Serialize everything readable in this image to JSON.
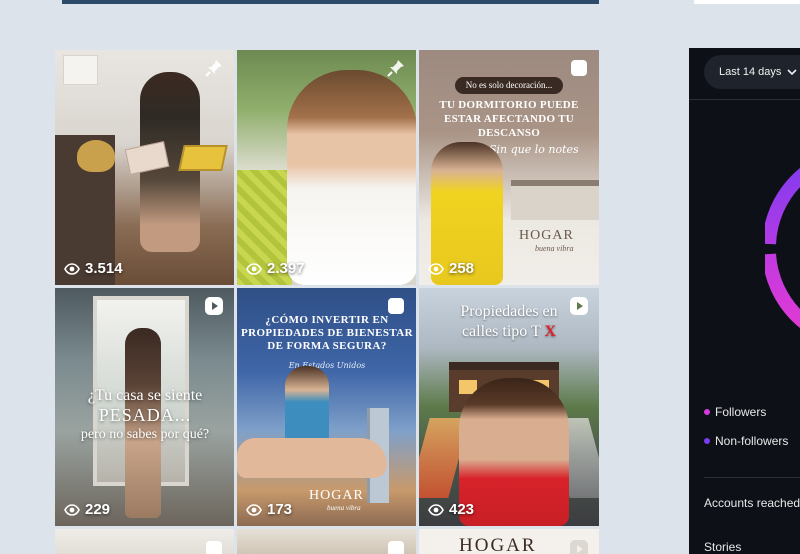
{
  "colors": {
    "page_bg": "#dce3ea",
    "panel_bg": "#0d1117",
    "followers_dot": "#d63adf",
    "non_followers_dot": "#7a3cf0"
  },
  "posts": [
    {
      "views": "3.514",
      "badge": "pin-icon"
    },
    {
      "views": "2.397",
      "badge": "pin-icon"
    },
    {
      "views": "258",
      "badge": "carousel-icon",
      "pill": "No es solo decoración...",
      "heading_lines": [
        "TU DORMITORIO PUEDE",
        "ESTAR AFECTANDO TU",
        "DESCANSO"
      ],
      "script": "Sin que lo notes",
      "brand": "HOGAR",
      "brand_sub": "buena vibra"
    },
    {
      "views": "229",
      "badge": "reel-icon",
      "lines": [
        "¿Tu casa se siente",
        "PESADA...",
        "pero no sabes por qué?"
      ]
    },
    {
      "views": "173",
      "badge": "carousel-icon",
      "heading_lines": [
        "¿CÓMO INVERTIR EN",
        "PROPIEDADES DE BIENESTAR",
        "DE FORMA SEGURA?"
      ],
      "sub": "En Estados Unidos",
      "brand": "HOGAR",
      "brand_sub": "buena vibra"
    },
    {
      "views": "423",
      "badge": "reel-icon",
      "heading_lines": [
        "Propiedades en",
        "calles tipo T"
      ],
      "mark": "X"
    },
    {
      "badge": ""
    },
    {
      "badge": ""
    },
    {
      "badge": "reel-icon",
      "brand": "HOGAR"
    }
  ],
  "insights": {
    "range_label": "Last 14 days",
    "legend": [
      {
        "label": "Followers"
      },
      {
        "label": "Non-followers"
      }
    ],
    "rows": [
      "Accounts reached",
      "Stories"
    ]
  }
}
